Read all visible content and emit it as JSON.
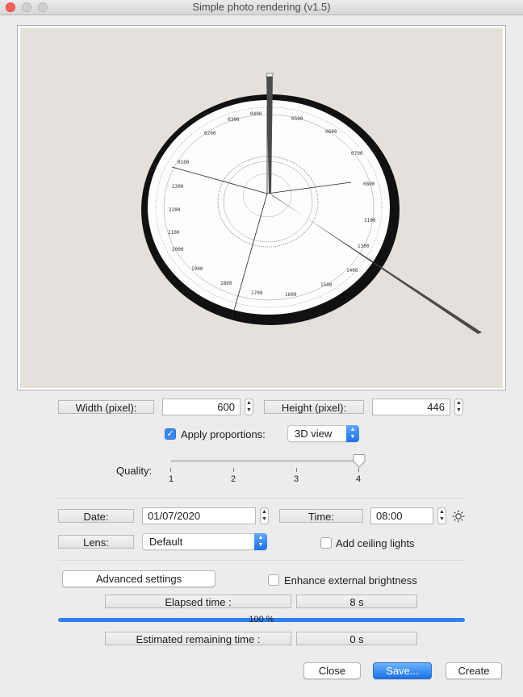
{
  "window": {
    "title": "Simple photo rendering (v1.5)"
  },
  "size": {
    "width_label": "Width (pixel):",
    "width_value": "600",
    "height_label": "Height (pixel):",
    "height_value": "446"
  },
  "proportions": {
    "label": "Apply proportions:",
    "checked": true,
    "view_value": "3D view"
  },
  "quality": {
    "label": "Quality:",
    "ticks": [
      "1",
      "2",
      "3",
      "4"
    ],
    "value": 4
  },
  "date": {
    "label": "Date:",
    "value": "01/07/2020"
  },
  "time": {
    "label": "Time:",
    "value": "08:00"
  },
  "lens": {
    "label": "Lens:",
    "value": "Default"
  },
  "ceiling_lights": {
    "label": "Add ceiling lights",
    "checked": false
  },
  "advanced_button": "Advanced settings",
  "brightness": {
    "label": "Enhance external brightness",
    "checked": false
  },
  "elapsed": {
    "label": "Elapsed time :",
    "value": "8 s"
  },
  "progress": {
    "percent": 100,
    "text": "100 %"
  },
  "remaining": {
    "label": "Estimated remaining time :",
    "value": "0 s"
  },
  "buttons": {
    "close": "Close",
    "save": "Save...",
    "create": "Create"
  },
  "colors": {
    "accent": "#2f7ff0",
    "close_button": "#fc5f57"
  }
}
